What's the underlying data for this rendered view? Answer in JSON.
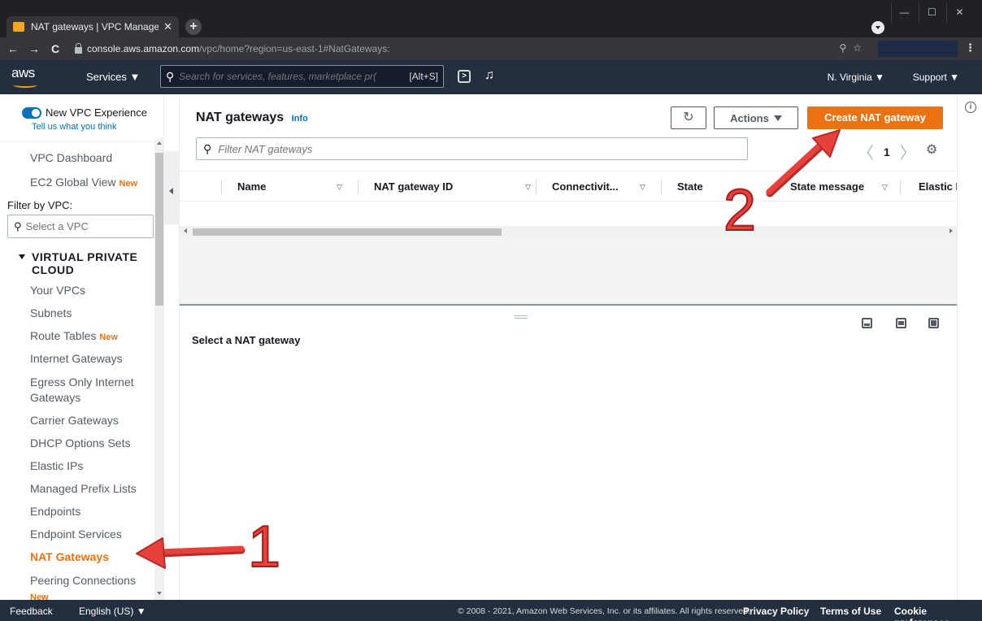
{
  "browser": {
    "tab_title": "NAT gateways | VPC Managemer",
    "url_host": "console.aws.amazon.com",
    "url_path": "/vpc/home?region=us-east-1#NatGateways:"
  },
  "topnav": {
    "logo": "aws",
    "services": "Services ▼",
    "search_placeholder": "Search for services, features, marketplace pr(",
    "search_shortcut": "[Alt+S]",
    "region": "N. Virginia ▼",
    "support": "Support ▼"
  },
  "sidebar": {
    "experience_title": "New VPC Experience",
    "experience_link": "Tell us what you think",
    "vpc_dashboard": "VPC Dashboard",
    "ec2_global_view": "EC2 Global View",
    "new_badge": "New",
    "filter_label": "Filter by VPC:",
    "vpc_select_placeholder": "Select a VPC",
    "section_title": "VIRTUAL PRIVATE CLOUD",
    "items": [
      {
        "label": "Your VPCs",
        "new": ""
      },
      {
        "label": "Subnets",
        "new": ""
      },
      {
        "label": "Route Tables",
        "new": "New"
      },
      {
        "label": "Internet Gateways",
        "new": ""
      },
      {
        "label": "Egress Only Internet Gateways",
        "new": ""
      },
      {
        "label": "Carrier Gateways",
        "new": ""
      },
      {
        "label": "DHCP Options Sets",
        "new": ""
      },
      {
        "label": "Elastic IPs",
        "new": ""
      },
      {
        "label": "Managed Prefix Lists",
        "new": ""
      },
      {
        "label": "Endpoints",
        "new": ""
      },
      {
        "label": "Endpoint Services",
        "new": ""
      },
      {
        "label": "NAT Gateways",
        "new": ""
      },
      {
        "label": "Peering Connections",
        "new": "New"
      }
    ]
  },
  "main": {
    "title": "NAT gateways",
    "info": "Info",
    "actions": "Actions",
    "create_button": "Create NAT gateway",
    "filter_placeholder": "Filter NAT gateways",
    "page": "1",
    "columns": [
      "Name",
      "NAT gateway ID",
      "Connectivit...",
      "State",
      "State message",
      "Elastic I"
    ],
    "detail_placeholder": "Select a NAT gateway"
  },
  "footer": {
    "feedback": "Feedback",
    "language": "English (US) ▼",
    "copyright": "© 2008 - 2021, Amazon Web Services, Inc. or its affiliates. All rights reserved.",
    "privacy": "Privacy Policy",
    "terms": "Terms of Use",
    "cookies": "Cookie preferences"
  },
  "annotations": {
    "step1": "1",
    "step2": "2"
  },
  "colors": {
    "aws_nav": "#232f3e",
    "accent_orange": "#ec7211",
    "link_blue": "#0073bb",
    "annotation_red": "#e8413c"
  }
}
